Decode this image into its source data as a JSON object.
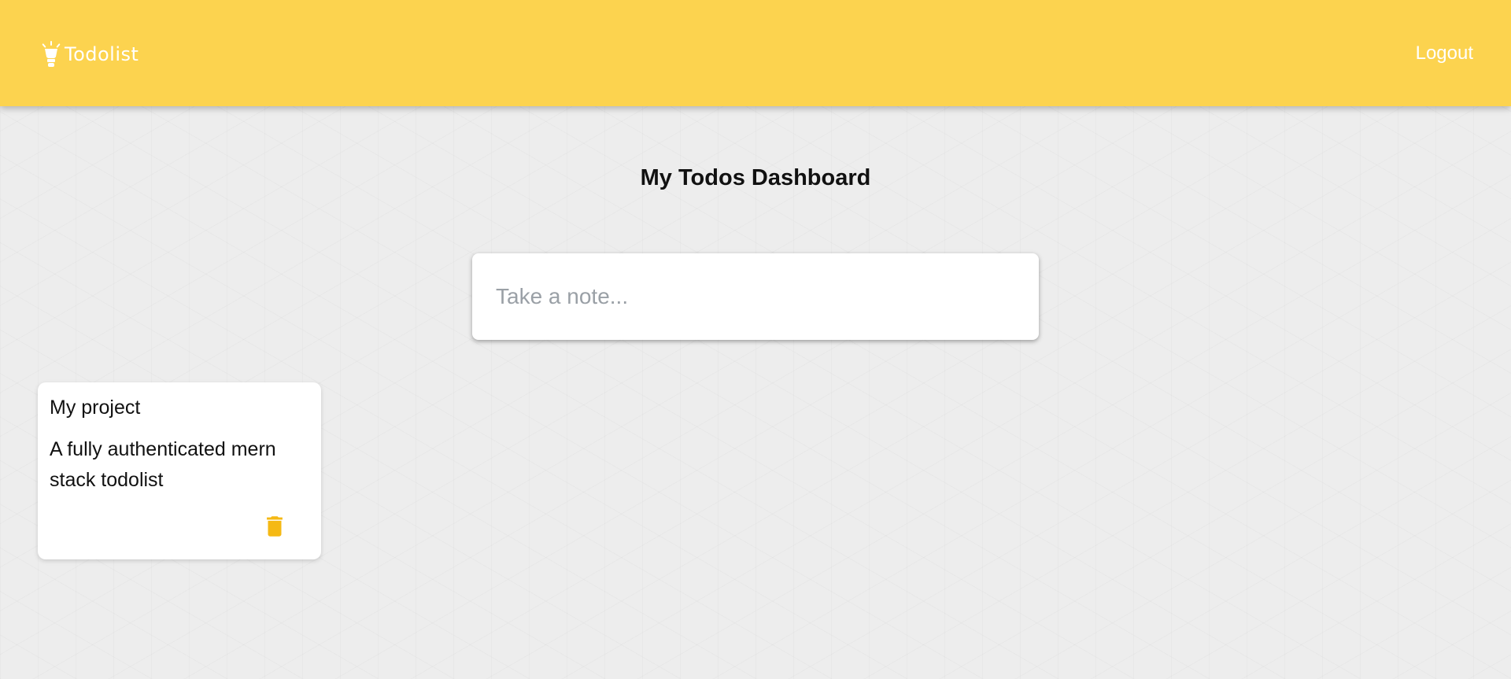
{
  "header": {
    "brand_icon": "lightbulb-icon",
    "brand_text": "Todolist",
    "logout_label": "Logout",
    "background_color": "#fcd34f"
  },
  "main": {
    "title": "My Todos Dashboard",
    "note_input": {
      "placeholder": "Take a note..."
    },
    "notes": [
      {
        "title": "My project",
        "content": "A fully authenticated mern stack todolist",
        "delete_icon": "trash-icon"
      }
    ]
  },
  "colors": {
    "accent": "#f5b914",
    "background": "#ededed"
  }
}
